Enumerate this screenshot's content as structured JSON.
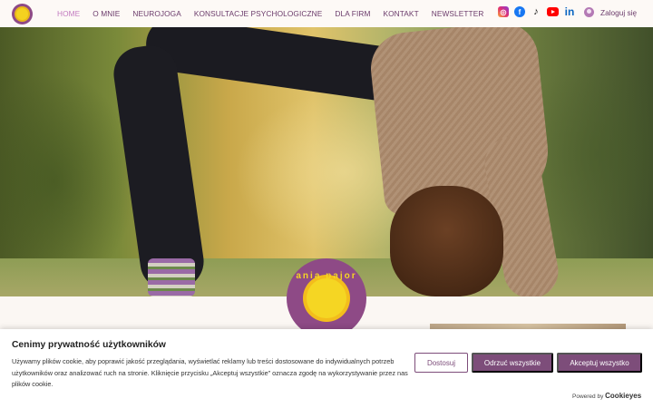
{
  "nav": {
    "items": [
      {
        "label": "HOME",
        "active": true
      },
      {
        "label": "O MNIE",
        "active": false
      },
      {
        "label": "NEUROJOGA",
        "active": false
      },
      {
        "label": "KONSULTACJE PSYCHOLOGICZNE",
        "active": false
      },
      {
        "label": "DLA FIRM",
        "active": false
      },
      {
        "label": "KONTAKT",
        "active": false
      },
      {
        "label": "NEWSLETTER",
        "active": false
      }
    ],
    "active_color": "#c27bc0",
    "text_color": "#6b3b6b"
  },
  "socials": {
    "icons": [
      "instagram-icon",
      "facebook-icon",
      "tiktok-icon",
      "youtube-icon",
      "linkedin-icon"
    ]
  },
  "login": {
    "label": "Zaloguj się"
  },
  "hero": {
    "badge_text": "ania pajor"
  },
  "cookie": {
    "title": "Cenimy prywatność użytkowników",
    "body": "Używamy plików cookie, aby poprawić jakość przeglądania, wyświetlać reklamy lub treści dostosowane do indywidualnych potrzeb użytkowników oraz analizować ruch na stronie. Kliknięcie przycisku „Akceptuj wszystkie” oznacza zgodę na wykorzystywanie przez nas plików cookie.",
    "buttons": {
      "customize": "Dostosuj",
      "reject": "Odrzuć wszystkie",
      "accept": "Akceptuj wszystko"
    },
    "powered_by": "Powered by",
    "brand": "Cookieyes",
    "accent_color": "#7d4d7a"
  }
}
